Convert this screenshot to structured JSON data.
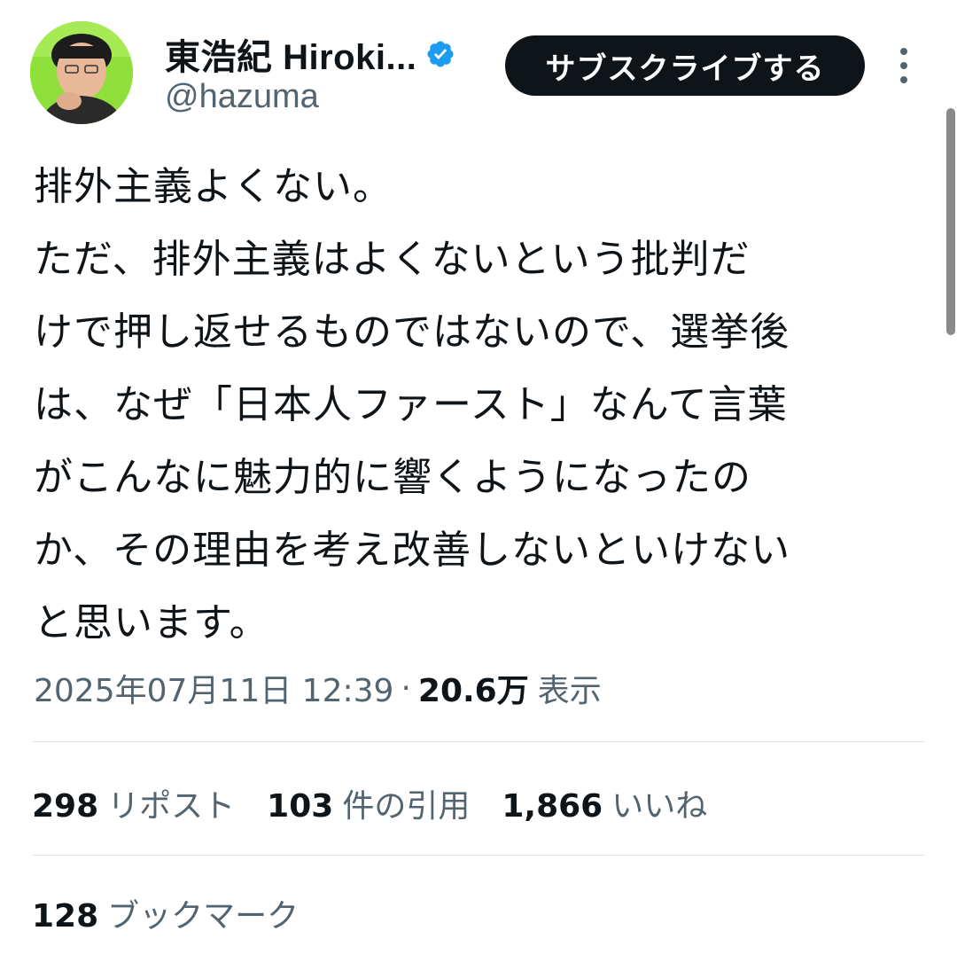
{
  "author": {
    "display_name": "東浩紀 Hiroki...",
    "handle": "@hazuma",
    "verified_icon": "verified-badge-icon",
    "avatar_bg": "#8fe03a"
  },
  "actions": {
    "subscribe_label": "サブスクライブする",
    "more_icon": "more-vertical-icon"
  },
  "tweet": {
    "lines": [
      "排外主義よくない。",
      "ただ、排外主義はよくないという批判だ",
      "けで押し返せるものではないので、選挙後",
      "は、なぜ「日本人ファースト」なんて言葉",
      "がこんなに魅力的に響くようになったの",
      "か、その理由を考え改善しないといけない",
      "と思います。"
    ]
  },
  "meta": {
    "timestamp": "2025年07月11日 12:39",
    "separator": "·",
    "views_count": "20.6万",
    "views_label": "表示"
  },
  "stats": {
    "reposts_count": "298",
    "reposts_label": "リポスト",
    "quotes_count": "103",
    "quotes_label": "件の引用",
    "likes_count": "1,866",
    "likes_label": "いいね",
    "bookmarks_count": "128",
    "bookmarks_label": "ブックマーク"
  },
  "colors": {
    "text_primary": "#0f1419",
    "text_secondary": "#536471",
    "verified_blue": "#1d9bf0",
    "divider": "#e1e6ea"
  }
}
